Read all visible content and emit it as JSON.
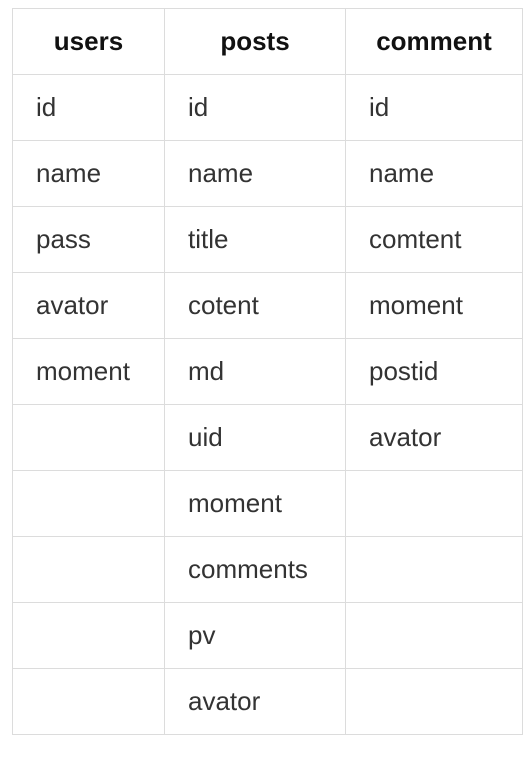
{
  "table": {
    "headers": [
      "users",
      "posts",
      "comment"
    ],
    "rows": [
      [
        "id",
        "id",
        "id"
      ],
      [
        "name",
        "name",
        "name"
      ],
      [
        "pass",
        "title",
        "comtent"
      ],
      [
        "avator",
        "cotent",
        "moment"
      ],
      [
        "moment",
        "md",
        "postid"
      ],
      [
        "",
        "uid",
        "avator"
      ],
      [
        "",
        "moment",
        ""
      ],
      [
        "",
        "comments",
        ""
      ],
      [
        "",
        "pv",
        ""
      ],
      [
        "",
        "avator",
        ""
      ]
    ]
  }
}
